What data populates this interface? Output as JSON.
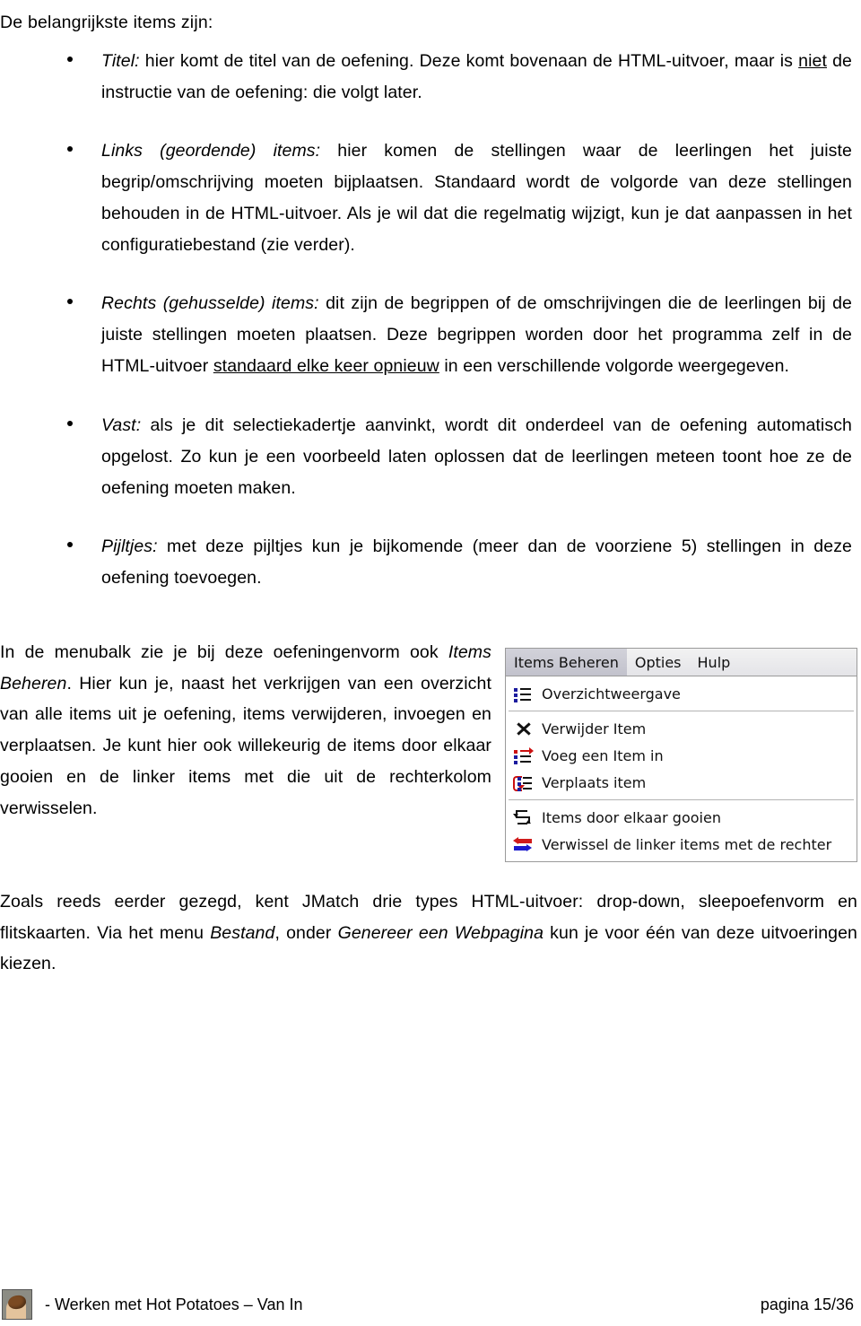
{
  "document": {
    "intro": "De belangrijkste items zijn:",
    "bullets": [
      {
        "term": "Titel:",
        "segments": [
          {
            "type": "text",
            "value": " hier komt de titel van de oefening. Deze komt bovenaan de HTML-uitvoer, maar is "
          },
          {
            "type": "underline",
            "value": "niet"
          },
          {
            "type": "text",
            "value": " de instructie van de oefening: die volgt later."
          }
        ],
        "plain": " hier komt de titel van de oefening. Deze komt bovenaan de HTML-uitvoer, maar is niet de instructie van de oefening: die volgt later."
      },
      {
        "term": "Links (geordende) items:",
        "plain": " hier komen de stellingen waar de leerlingen het juiste begrip/omschrijving moeten bijplaatsen. Standaard wordt de volgorde van deze stellingen behouden in de HTML-uitvoer. Als je wil dat die regelmatig wijzigt, kun je dat aanpassen in het configuratiebestand (zie verder)."
      },
      {
        "term": "Rechts (gehusselde) items:",
        "pre": " dit zijn de begrippen of de omschrijvingen die de leerlingen bij de juiste stellingen moeten plaatsen. Deze begrippen worden door het programma zelf in de HTML-uitvoer ",
        "underlined": "standaard elke keer opnieuw",
        "post": " in een verschillende volgorde weergegeven."
      },
      {
        "term": "Vast:",
        "plain": " als je dit selectiekadertje aanvinkt, wordt dit onderdeel van de oefening automatisch opgelost. Zo kun je een voorbeeld laten oplossen dat de leerlingen meteen toont hoe ze de oefening moeten maken."
      },
      {
        "term": "Pijltjes:",
        "plain": " met deze pijltjes kun je bijkomende (meer dan de voorziene 5) stellingen in deze oefening toevoegen."
      }
    ],
    "body_paragraph": {
      "pre": "In de menubalk zie je bij deze oefeningenvorm ook ",
      "italic": "Items Beheren",
      "post": ". Hier kun je, naast het verkrijgen van een overzicht van alle items uit je oefening, items verwijderen, invoegen en verplaatsen. Je kunt hier ook willekeurig de items door elkaar gooien en de linker items met die uit de rechterkolom verwisselen."
    },
    "closing_paragraph": {
      "s1": "Zoals reeds eerder gezegd, kent JMatch drie types HTML-uitvoer: drop-down, sleepoefenvorm en flitskaarten. Via het menu ",
      "i1": "Bestand",
      "s2": ", onder ",
      "i2": "Genereer een Webpagina",
      "s3": " kun je voor één van deze uitvoeringen kiezen."
    }
  },
  "menu_screenshot": {
    "menubar": [
      {
        "label": "Items Beheren",
        "active": true
      },
      {
        "label": "Opties",
        "active": false
      },
      {
        "label": "Hulp",
        "active": false
      }
    ],
    "groups": [
      [
        {
          "label": "Overzichtweergave",
          "icon": "list-view-icon"
        }
      ],
      [
        {
          "label": "Verwijder Item",
          "icon": "delete-x-icon"
        },
        {
          "label": "Voeg een Item in",
          "icon": "insert-item-icon"
        },
        {
          "label": "Verplaats item",
          "icon": "move-item-icon"
        }
      ],
      [
        {
          "label": "Items door elkaar gooien",
          "icon": "shuffle-icon"
        },
        {
          "label": "Verwissel de linker items met de rechter",
          "icon": "swap-columns-icon"
        }
      ]
    ],
    "colors": {
      "active_tab_bg": "#c9c9d2",
      "menubar_bg": "#eeeeee",
      "icon_blue": "#1b1b9e",
      "icon_red": "#cc1111",
      "border": "#9a9a9a"
    }
  },
  "footer": {
    "left_text": "- Werken met Hot Potatoes – Van In",
    "right_text": "pagina 15/36",
    "logo_icon": "hot-potatoes-logo-icon"
  }
}
